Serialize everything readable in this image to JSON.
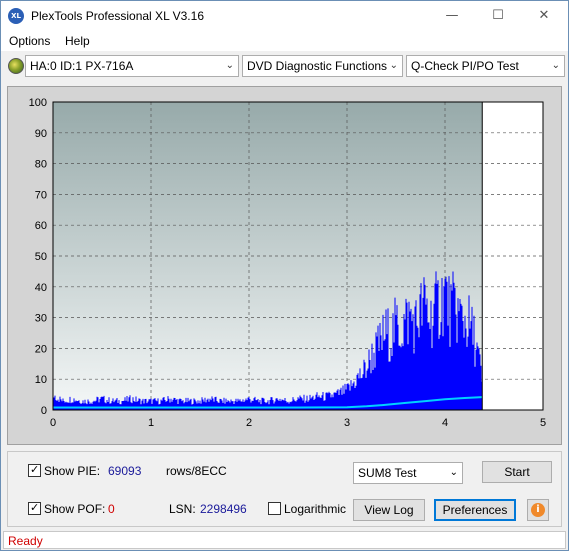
{
  "window": {
    "title": "PlexTools Professional XL V3.16",
    "icon_label": "XL",
    "controls": {
      "minimize": "—",
      "maximize": "☐",
      "close": "✕"
    }
  },
  "menu": {
    "options": "Options",
    "help": "Help"
  },
  "toolbar": {
    "drive": "HA:0 ID:1  PX-716A",
    "function": "DVD Diagnostic Functions",
    "test": "Q-Check PI/PO Test"
  },
  "chart_data": {
    "type": "area",
    "title": "",
    "xlabel": "",
    "ylabel": "",
    "xlim": [
      0,
      5
    ],
    "ylim": [
      0,
      100
    ],
    "x_ticks": [
      "0",
      "1",
      "2",
      "3",
      "4",
      "5"
    ],
    "y_ticks": [
      "0",
      "10",
      "20",
      "30",
      "40",
      "50",
      "60",
      "70",
      "80",
      "90",
      "100"
    ],
    "grid": true,
    "end_marker_x": 4.38,
    "series": [
      {
        "kind": "bars",
        "color": "#0000ff",
        "x": [
          0.0,
          0.1,
          0.2,
          0.3,
          0.4,
          0.5,
          0.6,
          0.7,
          0.8,
          0.9,
          1.0,
          1.1,
          1.2,
          1.3,
          1.4,
          1.5,
          1.6,
          1.7,
          1.8,
          1.9,
          2.0,
          2.1,
          2.2,
          2.3,
          2.4,
          2.5,
          2.6,
          2.7,
          2.8,
          2.9,
          3.0,
          3.05,
          3.1,
          3.15,
          3.2,
          3.25,
          3.3,
          3.35,
          3.4,
          3.45,
          3.5,
          3.55,
          3.6,
          3.65,
          3.7,
          3.75,
          3.8,
          3.85,
          3.9,
          3.95,
          4.0,
          4.05,
          4.1,
          4.15,
          4.2,
          4.25,
          4.3,
          4.35,
          4.38
        ],
        "values": [
          7,
          4,
          5,
          4,
          4,
          5,
          4,
          4,
          5,
          4,
          4,
          4,
          5,
          4,
          4,
          4,
          5,
          4,
          4,
          4,
          5,
          4,
          4,
          5,
          4,
          5,
          5,
          6,
          6,
          7,
          9,
          11,
          14,
          16,
          19,
          24,
          27,
          31,
          35,
          33,
          38,
          36,
          40,
          42,
          38,
          44,
          47,
          41,
          45,
          48,
          53,
          44,
          46,
          42,
          40,
          38,
          32,
          22,
          12
        ]
      },
      {
        "kind": "line",
        "color": "#00d0ff",
        "x": [
          0.0,
          0.5,
          1.0,
          1.5,
          2.0,
          2.5,
          3.0,
          3.2,
          3.4,
          3.6,
          3.8,
          4.0,
          4.2,
          4.38
        ],
        "values": [
          0.8,
          0.8,
          0.8,
          0.8,
          0.8,
          0.8,
          0.9,
          1.2,
          1.7,
          2.3,
          2.9,
          3.5,
          3.9,
          4.2
        ]
      }
    ]
  },
  "controls": {
    "show_pie_label": "Show PIE:",
    "show_pie_checked": true,
    "pie_value": "69093",
    "pie_unit": "rows/8ECC",
    "show_pof_label": "Show POF:",
    "show_pof_checked": true,
    "pof_value": "0",
    "lsn_label": "LSN:",
    "lsn_value": "2298496",
    "logarithmic_label": "Logarithmic",
    "logarithmic_checked": false,
    "test_mode": "SUM8 Test",
    "start_button": "Start",
    "view_log_button": "View Log",
    "preferences_button": "Preferences",
    "info_icon": "i"
  },
  "status": {
    "text": "Ready"
  }
}
